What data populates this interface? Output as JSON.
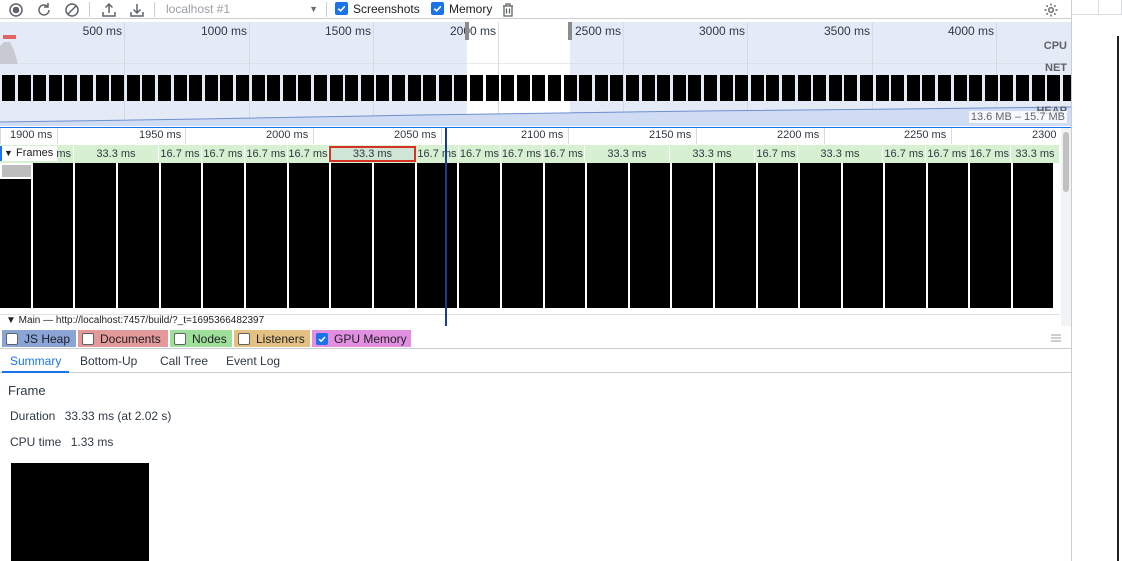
{
  "toolbar": {
    "target": "localhost #1",
    "screenshots_label": "Screenshots",
    "memory_label": "Memory",
    "icons": [
      "record-icon",
      "reload-icon",
      "clear-icon",
      "upload-icon",
      "download-icon",
      "trash-icon",
      "gear-icon"
    ]
  },
  "overview": {
    "ticks": [
      "500 ms",
      "1000 ms",
      "1500 ms",
      "2000 ms",
      "2500 ms",
      "3000 ms",
      "3500 ms",
      "4000 ms"
    ],
    "tracks": {
      "cpu": "CPU",
      "net": "NET",
      "heap": "HEAP"
    },
    "heap_value": "13.6 MB – 15.7 MB"
  },
  "ruler": {
    "ticks": [
      "1900 ms",
      "1950 ms",
      "2000 ms",
      "2050 ms",
      "2100 ms",
      "2150 ms",
      "2200 ms",
      "2250 ms",
      "2300"
    ]
  },
  "frames": {
    "label": "Frames",
    "segments": [
      "ms",
      "33.3 ms",
      "16.7 ms",
      "16.7 ms",
      "16.7 ms",
      "16.7 ms",
      "33.3 ms",
      "16.7 ms",
      "16.7 ms",
      "16.7 ms",
      "16.7 ms",
      "33.3 ms",
      "33.3 ms",
      "16.7 ms",
      "33.3 ms",
      "16.7 ms",
      "16.7 ms",
      "16.7 ms",
      "33.3 ms"
    ],
    "selected_index": 6
  },
  "main_track": "▼ Main — http://localhost:7457/build/?_t=1695366482397",
  "memory_toggles": [
    {
      "label": "JS Heap",
      "checked": false,
      "color": "#8aa4d6"
    },
    {
      "label": "Documents",
      "checked": false,
      "color": "#e49a9a"
    },
    {
      "label": "Nodes",
      "checked": false,
      "color": "#9ee09a"
    },
    {
      "label": "Listeners",
      "checked": false,
      "color": "#e4c083"
    },
    {
      "label": "GPU Memory",
      "checked": true,
      "color": "#e28fe2"
    }
  ],
  "tabs": [
    "Summary",
    "Bottom-Up",
    "Call Tree",
    "Event Log"
  ],
  "summary": {
    "title": "Frame",
    "duration_label": "Duration",
    "duration_value": "33.33 ms (at 2.02 s)",
    "cpu_label": "CPU time",
    "cpu_value": "1.33 ms"
  }
}
